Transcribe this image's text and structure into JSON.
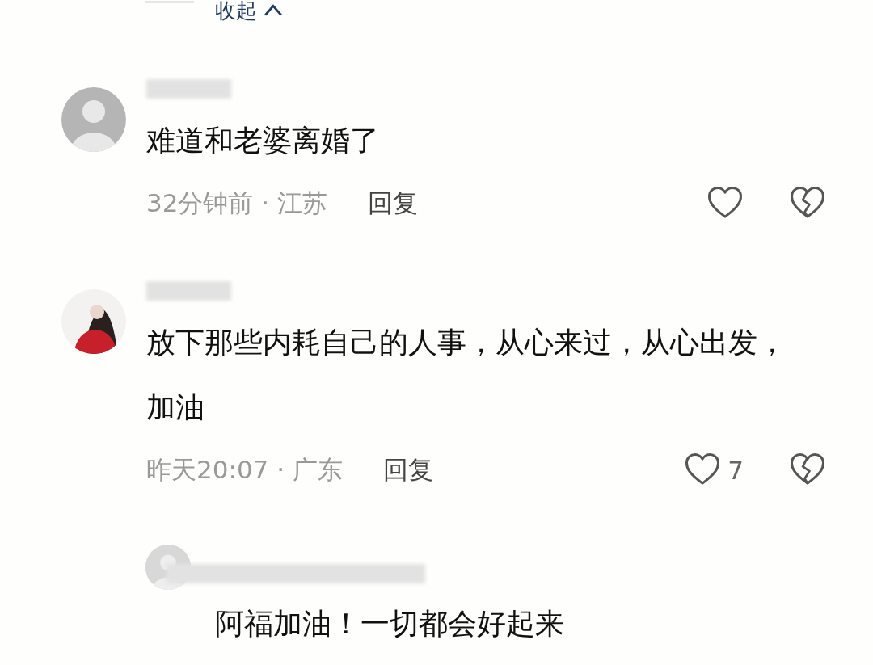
{
  "collapse": {
    "label": "收起"
  },
  "comments": [
    {
      "kind": "comment",
      "text": "难道和老婆离婚了",
      "time": "32分钟前 · 江苏",
      "reply": "回复"
    },
    {
      "kind": "comment",
      "text": "放下那些内耗自己的人事，从心来过，从心出发，加油",
      "time": "昨天20:07 · 广东",
      "reply": "回复",
      "likes": "7"
    },
    {
      "kind": "reply",
      "text": "阿福加油！一切都会好起来"
    }
  ]
}
